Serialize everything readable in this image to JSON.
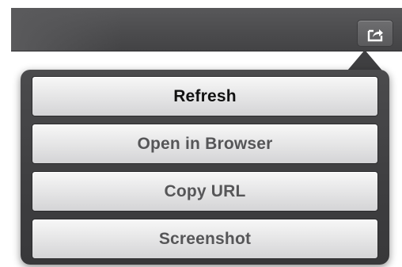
{
  "toolbar": {
    "share_icon": "share-icon"
  },
  "popover": {
    "items": [
      {
        "label": "Refresh",
        "primary": true
      },
      {
        "label": "Open in Browser",
        "primary": false
      },
      {
        "label": "Copy URL",
        "primary": false
      },
      {
        "label": "Screenshot",
        "primary": false
      }
    ]
  },
  "colors": {
    "toolbar": "#4c4c4e",
    "popover": "#3f3f41",
    "button_face": "#e4e4e5",
    "primary_text": "#111111",
    "secondary_text": "#565658"
  }
}
